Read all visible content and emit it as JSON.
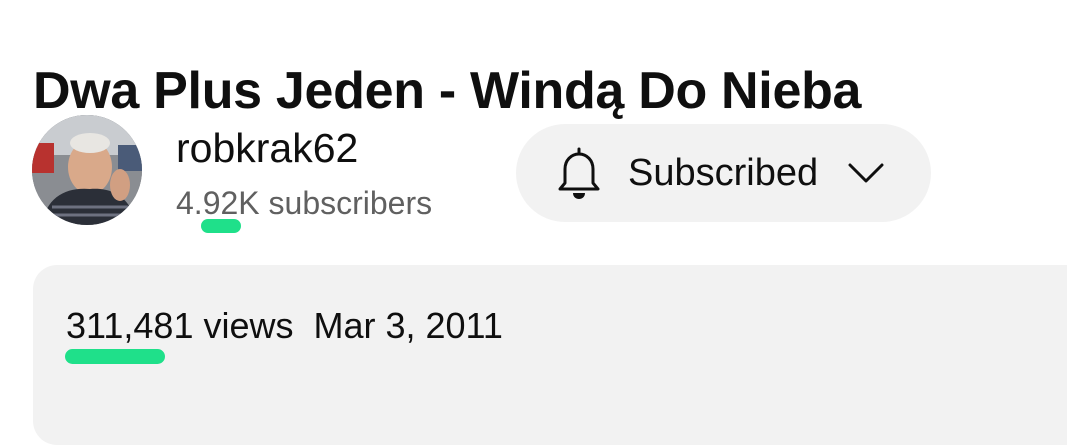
{
  "video": {
    "title": "Dwa Plus Jeden - Windą Do Nieba"
  },
  "channel": {
    "name": "robkrak62",
    "subscribers": "4.92K subscribers",
    "avatar_icon": "user-avatar"
  },
  "subscribe": {
    "label": "Subscribed",
    "bell_icon": "bell-icon",
    "dropdown_icon": "chevron-down-icon"
  },
  "description": {
    "views": "311,481 views",
    "date": "Mar 3, 2011"
  },
  "colors": {
    "text_primary": "#0f0f0f",
    "text_secondary": "#606060",
    "button_bg": "#f2f2f2",
    "description_bg": "#f2f2f2",
    "highlight_mark": "#1fe08a"
  }
}
